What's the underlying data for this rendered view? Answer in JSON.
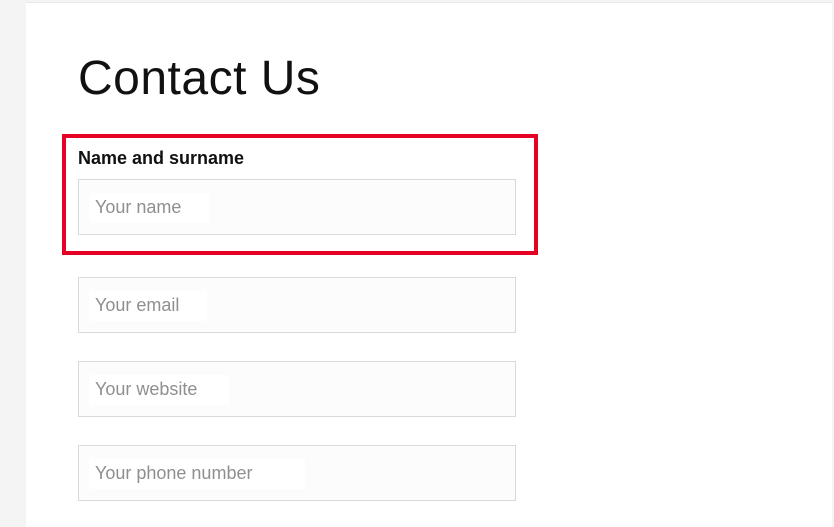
{
  "page": {
    "title": "Contact Us"
  },
  "form": {
    "highlightColor": "#e60023",
    "fields": {
      "name": {
        "label": "Name and surname",
        "placeholder": "Your name",
        "value": "",
        "highlighted": true
      },
      "email": {
        "placeholder": "Your email",
        "value": ""
      },
      "website": {
        "placeholder": "Your website",
        "value": ""
      },
      "phone": {
        "placeholder": "Your phone number",
        "value": ""
      }
    }
  }
}
